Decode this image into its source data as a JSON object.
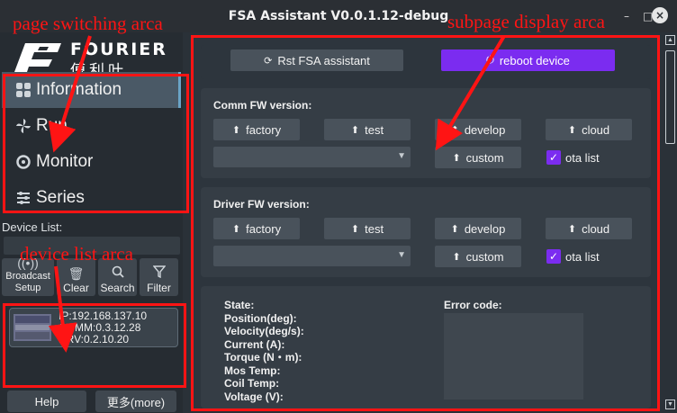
{
  "window": {
    "title": "FSA Assistant V0.0.1.12-debug",
    "minimize_glyph": "–",
    "maximize_glyph": "□",
    "close_glyph": "×"
  },
  "logo": {
    "word": "FOURIER",
    "cn": "傅利叶"
  },
  "nav": {
    "items": [
      {
        "label": "Information",
        "icon": "grid-icon"
      },
      {
        "label": "Run",
        "icon": "fan-icon"
      },
      {
        "label": "Monitor",
        "icon": "monitor-icon"
      },
      {
        "label": "Series",
        "icon": "sliders-icon"
      }
    ]
  },
  "device_panel": {
    "label": "Device List:",
    "tools": [
      {
        "label": "Broadcast\nSetup",
        "icon": "broadcast-icon"
      },
      {
        "label": "Clear",
        "icon": "trash-icon"
      },
      {
        "label": "Search",
        "icon": "search-icon"
      },
      {
        "label": "Filter",
        "icon": "filter-icon"
      }
    ],
    "devices": [
      {
        "ip": "IP:192.168.137.10",
        "comm": "COMM:0.3.12.28",
        "drv": "DRV:0.2.10.20"
      }
    ]
  },
  "footer": {
    "help": "Help",
    "more": "更多(more)"
  },
  "main": {
    "rst_label": "Rst FSA assistant",
    "reboot_label": "reboot device",
    "comm_fw": {
      "label": "Comm FW version:",
      "buttons": [
        "factory",
        "test",
        "develop",
        "cloud"
      ],
      "custom": "custom",
      "ota": "ota list"
    },
    "driver_fw": {
      "label": "Driver FW version:",
      "buttons": [
        "factory",
        "test",
        "develop",
        "cloud"
      ],
      "custom": "custom",
      "ota": "ota list"
    },
    "state": {
      "labels": [
        "State:",
        "Position(deg):",
        "Velocity(deg/s):",
        "Current (A):",
        "Torque (N・m):",
        "Mos Temp:",
        "Coil Temp:",
        "Voltage (V):"
      ],
      "error_label": "Error code:"
    }
  },
  "annotations": {
    "page_switching": "page switching arca",
    "subpage": "subpage display arca",
    "device_list": "device list arca",
    "color": "#ff1414"
  },
  "colors": {
    "accent": "#7b2cf0",
    "background": "#2a3138",
    "annotation": "#ff1414"
  }
}
